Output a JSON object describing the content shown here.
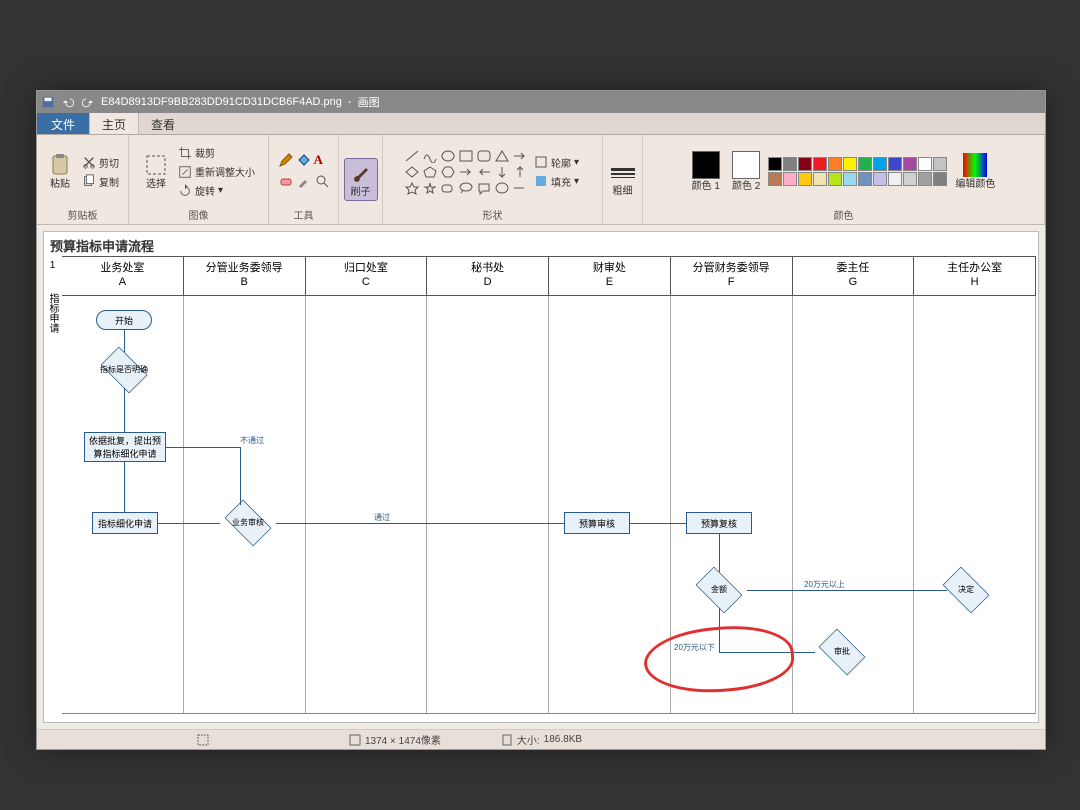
{
  "app": {
    "title_file": "E84D8913DF9BB283DD91CD31DCB6F4AD.png",
    "title_app": "画图"
  },
  "tabs": {
    "file": "文件",
    "home": "主页",
    "view": "查看"
  },
  "ribbon": {
    "clipboard": {
      "label": "剪贴板",
      "paste": "粘贴",
      "cut": "剪切",
      "copy": "复制"
    },
    "image": {
      "label": "图像",
      "select": "选择",
      "crop": "裁剪",
      "resize": "重新调整大小",
      "rotate": "旋转"
    },
    "tools": {
      "label": "工具"
    },
    "brushes": {
      "label": "刷子"
    },
    "shapes": {
      "label": "形状",
      "outline": "轮廓",
      "fill": "填充"
    },
    "thickness": {
      "label": "粗细"
    },
    "colors": {
      "label": "颜色",
      "c1": "颜色 1",
      "c2": "颜色 2",
      "edit": "编辑颜色",
      "c1_value": "#000000",
      "c2_value": "#ffffff",
      "palette": [
        "#000000",
        "#7f7f7f",
        "#880015",
        "#ed1c24",
        "#ff7f27",
        "#fff200",
        "#22b14c",
        "#00a2e8",
        "#3f48cc",
        "#a349a4",
        "#ffffff",
        "#c3c3c3",
        "#b97a57",
        "#ffaec9",
        "#ffc90e",
        "#efe4b0",
        "#b5e61d",
        "#99d9ea",
        "#7092be",
        "#c8bfe7",
        "#f0f0f0",
        "#d0d0d0",
        "#a0a0a0",
        "#808080"
      ]
    }
  },
  "document": {
    "title": "预算指标申请流程",
    "row_label_1": "1",
    "row_label_2": "指标申请",
    "lanes": [
      {
        "name": "业务处室",
        "letter": "A"
      },
      {
        "name": "分管业务委领导",
        "letter": "B"
      },
      {
        "name": "归口处室",
        "letter": "C"
      },
      {
        "name": "秘书处",
        "letter": "D"
      },
      {
        "name": "财审处",
        "letter": "E"
      },
      {
        "name": "分管财务委领导",
        "letter": "F"
      },
      {
        "name": "委主任",
        "letter": "G"
      },
      {
        "name": "主任办公室",
        "letter": "H"
      }
    ],
    "nodes": {
      "start": "开始",
      "n1": "指标是否明确",
      "n2": "依据批复，提出预算指标细化申请",
      "n3": "指标细化申请",
      "b1": "业务审核",
      "e1": "预算审核",
      "f1": "预算复核",
      "f2": "金额",
      "g1": "审批",
      "h1": "决定"
    },
    "edge_labels": {
      "fail": "不通过",
      "pass": "通过",
      "over20": "20万元以上",
      "under20": "20万元以下"
    }
  },
  "statusbar": {
    "dims": "1374 × 1474像素",
    "size_label": "大小:",
    "size_value": "186.8KB"
  }
}
